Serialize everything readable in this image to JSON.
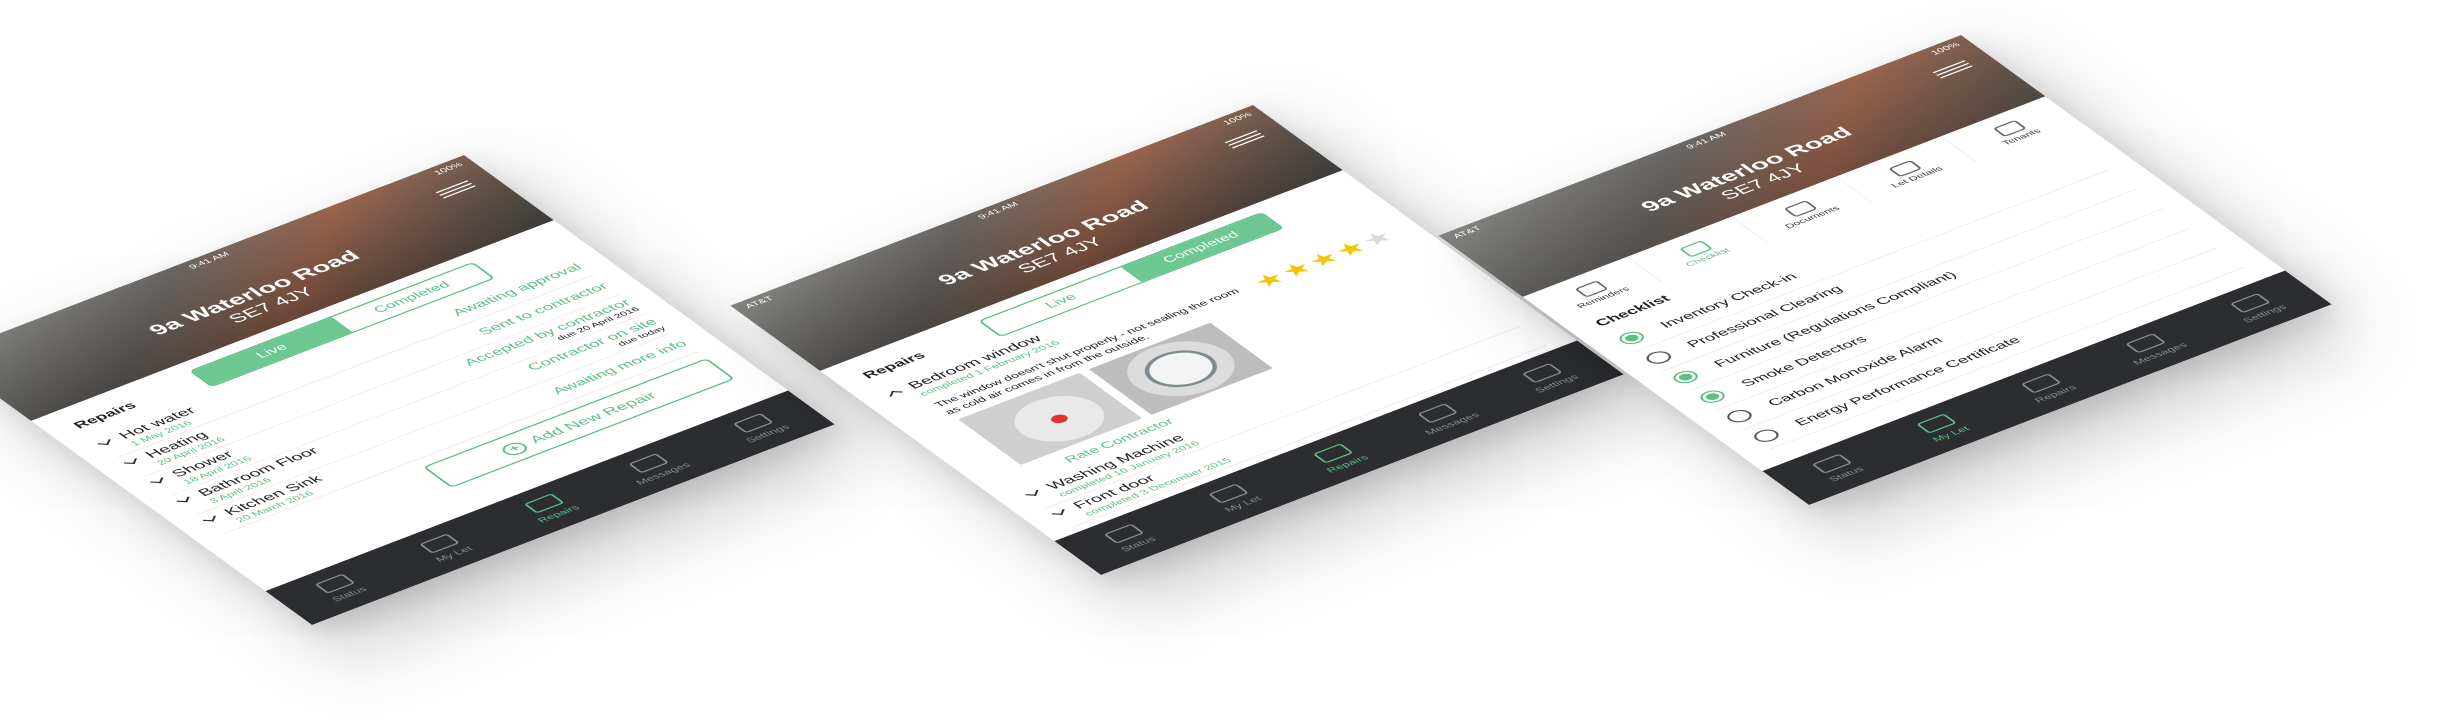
{
  "common": {
    "carrier": "AT&T",
    "time": "9:41 AM",
    "battery": "100%",
    "address_line1": "9a Waterloo Road",
    "address_line2": "SE7 4JY",
    "tabbar": [
      "Status",
      "My Let",
      "Repairs",
      "Messages",
      "Settings"
    ]
  },
  "repairs_live": {
    "title": "Repairs",
    "segment": [
      "Live",
      "Completed"
    ],
    "items": [
      {
        "name": "Hot water",
        "date": "1 May 2016",
        "status": "Awaiting approval",
        "note": ""
      },
      {
        "name": "Heating",
        "date": "20 April 2016",
        "status": "Sent to contractor",
        "note": ""
      },
      {
        "name": "Shower",
        "date": "18 April 2016",
        "status": "Accepted by contractor",
        "note": "due 20 April 2016"
      },
      {
        "name": "Bathroom Floor",
        "date": "3 April 2016",
        "status": "Contractor on site",
        "note": "due today"
      },
      {
        "name": "Kitchen Sink",
        "date": "20 March 2016",
        "status": "Awaiting more info",
        "note": ""
      }
    ],
    "add_button": "Add New Repair"
  },
  "repairs_completed": {
    "title": "Repairs",
    "segment": [
      "Live",
      "Completed"
    ],
    "expanded": {
      "name": "Bedroom window",
      "date": "completed 1 February 2016",
      "description": "The window doesn't shut properly - not sealing the room as cold air comes in from the outside.",
      "rating": 4,
      "rating_max": 5,
      "rate_link": "Rate Contractor"
    },
    "items": [
      {
        "name": "Washing Machine",
        "date": "completed 10 January 2016"
      },
      {
        "name": "Front door",
        "date": "completed 3 December 2015"
      }
    ]
  },
  "checklist": {
    "top_tabs": [
      "Reminders",
      "Checklist",
      "Documents",
      "Let Details",
      "Tenants"
    ],
    "active_top_tab": "Checklist",
    "title": "Checklist",
    "items": [
      {
        "label": "Inventory Check-in",
        "done": true
      },
      {
        "label": "Professional Clearing",
        "done": false
      },
      {
        "label": "Furniture (Regulations Compliant)",
        "done": true
      },
      {
        "label": "Smoke Detectors",
        "done": true
      },
      {
        "label": "Carbon Monoxide Alarm",
        "done": false
      },
      {
        "label": "Energy Performance Certificate",
        "done": false
      }
    ]
  },
  "colors": {
    "accent": "#5cbf83",
    "tabbar": "#2b2d30"
  }
}
